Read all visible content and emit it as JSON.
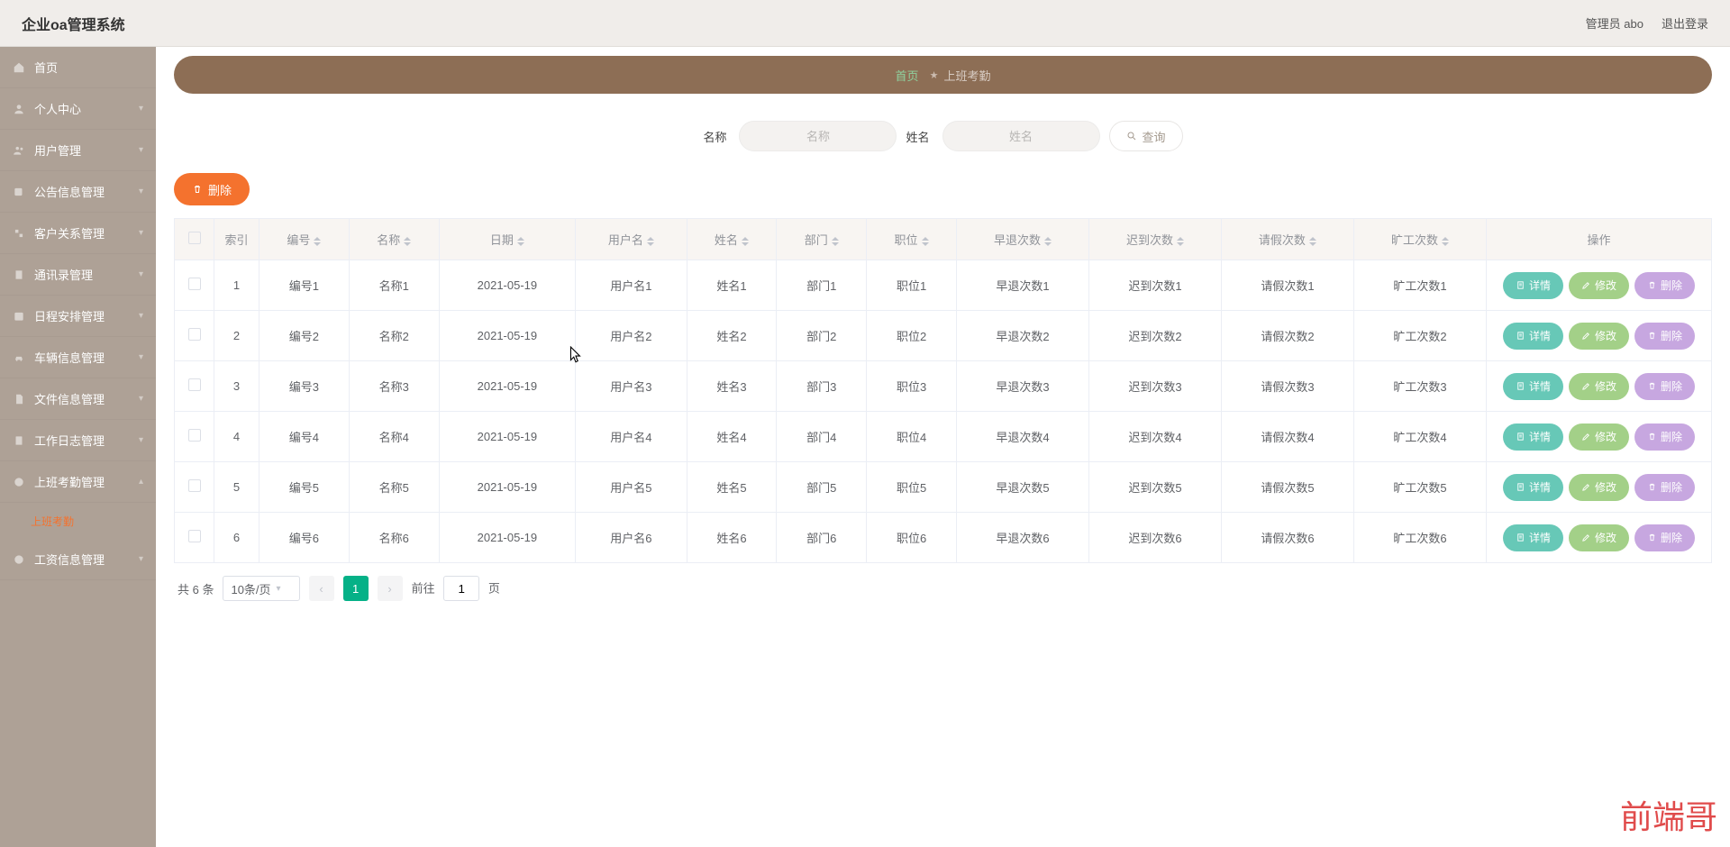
{
  "header": {
    "title": "企业oa管理系统",
    "admin_label": "管理员 abo",
    "logout_label": "退出登录"
  },
  "sidebar": {
    "items": [
      {
        "label": "首页"
      },
      {
        "label": "个人中心"
      },
      {
        "label": "用户管理"
      },
      {
        "label": "公告信息管理"
      },
      {
        "label": "客户关系管理"
      },
      {
        "label": "通讯录管理"
      },
      {
        "label": "日程安排管理"
      },
      {
        "label": "车辆信息管理"
      },
      {
        "label": "文件信息管理"
      },
      {
        "label": "工作日志管理"
      },
      {
        "label": "上班考勤管理"
      },
      {
        "label": "工资信息管理"
      }
    ],
    "active_child_label": "上班考勤"
  },
  "breadcrumb": {
    "home": "首页",
    "current": "上班考勤"
  },
  "filters": {
    "name_label": "名称",
    "name_ph": "名称",
    "xing_label": "姓名",
    "xing_ph": "姓名",
    "query_label": "查询"
  },
  "toolbar": {
    "delete_label": "删除"
  },
  "table": {
    "columns": [
      "索引",
      "编号",
      "名称",
      "日期",
      "用户名",
      "姓名",
      "部门",
      "职位",
      "早退次数",
      "迟到次数",
      "请假次数",
      "旷工次数",
      "操作"
    ],
    "rows": [
      {
        "idx": "1",
        "no": "编号1",
        "name": "名称1",
        "date": "2021-05-19",
        "user": "用户名1",
        "xing": "姓名1",
        "dept": "部门1",
        "pos": "职位1",
        "early": "早退次数1",
        "late": "迟到次数1",
        "leave": "请假次数1",
        "absent": "旷工次数1"
      },
      {
        "idx": "2",
        "no": "编号2",
        "name": "名称2",
        "date": "2021-05-19",
        "user": "用户名2",
        "xing": "姓名2",
        "dept": "部门2",
        "pos": "职位2",
        "early": "早退次数2",
        "late": "迟到次数2",
        "leave": "请假次数2",
        "absent": "旷工次数2"
      },
      {
        "idx": "3",
        "no": "编号3",
        "name": "名称3",
        "date": "2021-05-19",
        "user": "用户名3",
        "xing": "姓名3",
        "dept": "部门3",
        "pos": "职位3",
        "early": "早退次数3",
        "late": "迟到次数3",
        "leave": "请假次数3",
        "absent": "旷工次数3"
      },
      {
        "idx": "4",
        "no": "编号4",
        "name": "名称4",
        "date": "2021-05-19",
        "user": "用户名4",
        "xing": "姓名4",
        "dept": "部门4",
        "pos": "职位4",
        "early": "早退次数4",
        "late": "迟到次数4",
        "leave": "请假次数4",
        "absent": "旷工次数4"
      },
      {
        "idx": "5",
        "no": "编号5",
        "name": "名称5",
        "date": "2021-05-19",
        "user": "用户名5",
        "xing": "姓名5",
        "dept": "部门5",
        "pos": "职位5",
        "early": "早退次数5",
        "late": "迟到次数5",
        "leave": "请假次数5",
        "absent": "旷工次数5"
      },
      {
        "idx": "6",
        "no": "编号6",
        "name": "名称6",
        "date": "2021-05-19",
        "user": "用户名6",
        "xing": "姓名6",
        "dept": "部门6",
        "pos": "职位6",
        "early": "早退次数6",
        "late": "迟到次数6",
        "leave": "请假次数6",
        "absent": "旷工次数6"
      }
    ],
    "row_actions": {
      "detail": "详情",
      "edit": "修改",
      "delete": "删除"
    }
  },
  "pager": {
    "total_text": "共 6 条",
    "page_size": "10条/页",
    "current": "1",
    "jump_prefix": "前往",
    "jump_value": "1",
    "jump_suffix": "页"
  },
  "watermark": "前端哥"
}
